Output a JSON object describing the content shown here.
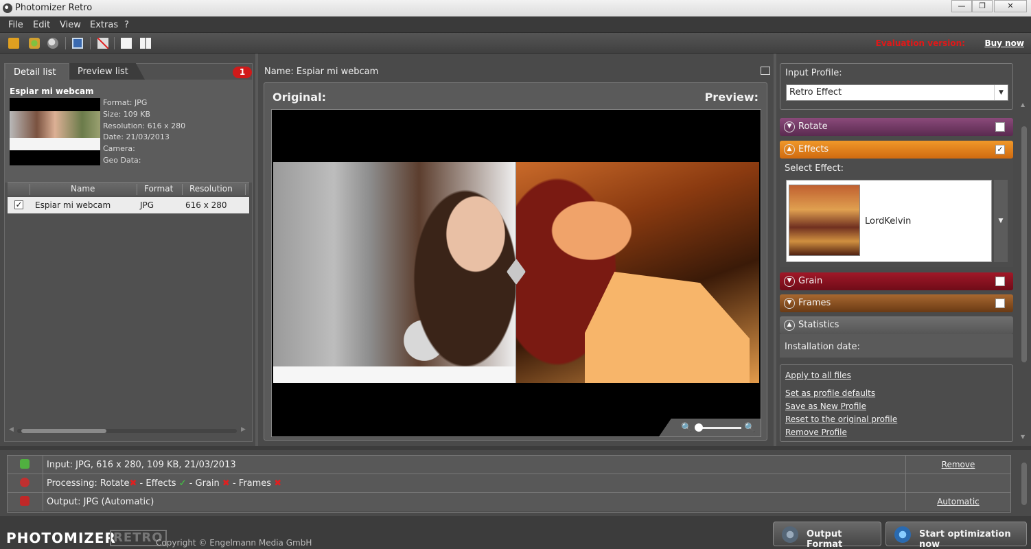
{
  "window": {
    "title": "Photomizer Retro",
    "min": "—",
    "max": "❐",
    "close": "✕"
  },
  "menu": [
    "File",
    "Edit",
    "View",
    "Extras",
    "?"
  ],
  "toolbar": {
    "eval_text": "Evaluation version:",
    "buy_now": "Buy now"
  },
  "left_panel": {
    "tabs": [
      "Detail list",
      "Preview list"
    ],
    "badge_count": "1",
    "file": {
      "name": "Espiar mi webcam",
      "meta": [
        "Format: JPG",
        "Size: 109 KB",
        "Resolution: 616 x 280",
        "Date: 21/03/2013",
        "Camera:",
        "Geo Data:"
      ]
    },
    "columns": [
      "Name",
      "Format",
      "Resolution"
    ],
    "rows": [
      {
        "check": "✓",
        "name": "Espiar mi webcam",
        "format": "JPG",
        "resolution": "616 x 280"
      }
    ],
    "scroll_left": "◀",
    "scroll_right": "▶"
  },
  "center": {
    "name_label": "Name: Espiar mi webcam",
    "original_label": "Original:",
    "preview_label": "Preview:"
  },
  "right_panel": {
    "input_profile_label": "Input Profile:",
    "input_profile_value": "Retro Effect",
    "dropdown_arrow": "▼",
    "sections": {
      "rotate": {
        "label": "Rotate",
        "checked": ""
      },
      "effects": {
        "label": "Effects",
        "checked": "✓"
      },
      "grain": {
        "label": "Grain",
        "checked": ""
      },
      "frames": {
        "label": "Frames",
        "checked": ""
      },
      "statistics": {
        "label": "Statistics"
      }
    },
    "chevron_down": "▼",
    "chevron_up": "▲",
    "select_effect_label": "Select Effect:",
    "effect_name": "LordKelvin",
    "installation_date_label": "Installation date:",
    "links": [
      "Apply to all files",
      "Set as profile defaults",
      "Save as New Profile",
      "Reset to the original profile",
      "Remove Profile"
    ]
  },
  "status": {
    "input": {
      "text": "Input: JPG, 616 x 280, 109 KB, 21/03/2013",
      "action": "Remove"
    },
    "processing": {
      "prefix": "Processing: Rotate",
      "x": "✖",
      "sep1": " - Effects ",
      "ok": "✓",
      "sep2": " - Grain ",
      "sep3": " - Frames ",
      "action": ""
    },
    "output": {
      "text": "Output: JPG (Automatic)",
      "action": "Automatic"
    }
  },
  "footer": {
    "logo_main": "PHOTOMIZER",
    "logo_sub": "RETRO",
    "copyright": "Copyright © Engelmann Media GmbH",
    "output_format_button": "Output Format",
    "start_button": "Start optimization now"
  },
  "colors": {
    "accent_orange": "#e8861e",
    "rotate": "#6e3a62",
    "grain": "#880f20",
    "frames": "#8a5020",
    "eval_red": "#e01818"
  }
}
